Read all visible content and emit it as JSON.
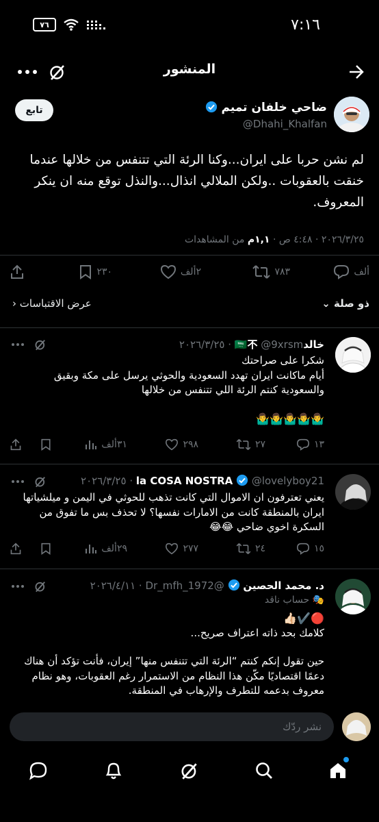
{
  "status_bar": {
    "time": "٧:١٦",
    "battery": "٧٦"
  },
  "header": {
    "title": "المنشور"
  },
  "post": {
    "author_name": "ضاحي خلفان تميم",
    "author_handle": "@Dhahi_Khalfan",
    "follow_label": "تابع",
    "text": "لم نشن حربا على ايران...وكنا الرئة التي تتنفس من خلالها عندما خنقت بالعقوبات ..ولكن الملالي انذال...والنذل توقع منه ان ينكر المعروف.",
    "time": "٤:٤٨ ص",
    "date": "٢٠٢٦/٣/٢٥",
    "views_count": "١,١م",
    "views_label": "من المشاهدات",
    "replies": "ألف",
    "reposts": "٧٨٣",
    "likes": "٢ألف",
    "bookmarks": "٢٣٠"
  },
  "replies_bar": {
    "sort_label": "ذو صلة",
    "quotes_label": "عرض الاقتباسات"
  },
  "replies": [
    {
      "name": "خالد🇸🇦不",
      "handle": "@9xrsm",
      "date": "٢٠٢٦/٣/٢٥",
      "text_lines": [
        "شكرا على صراحتك",
        "أيام ماكانت ايران تهدد السعودية والحوثي يرسل على مكة وبقيق والسعودية كنتم الرئة اللي تتنفس من خلالها",
        "",
        "🤷‍♂️🤷‍♂️🤷‍♂️🤷‍♂️🤷‍♂️"
      ],
      "reply_count": "١٣",
      "repost_count": "٢٧",
      "like_count": "٢٩٨",
      "view_count": "٣١ألف"
    },
    {
      "name": "la COSA NOSTRA",
      "handle": "@lovelyboy21",
      "date": "٢٠٢٦/٣/٢٥",
      "text_lines": [
        "يعني تعترفون ان الاموال التي كانت تذهب للحوثي في اليمن و ميلشياتها ايران بالمنطقة كانت من الامارات نفسها؟ لا تحذف بس ما تفوق من السكرة اخوي ضاحي 😂😂"
      ],
      "reply_count": "١٥",
      "repost_count": "٢٤",
      "like_count": "٢٧٧",
      "view_count": "٢٩ألف"
    },
    {
      "name": "د. محمد الحصين",
      "handle": "@Dr_mfh_1972",
      "date": "٢٠٢٦/٤/١١",
      "badge": "حساب ناقد",
      "text_lines": [
        "🔴✔️👍🏻",
        "كلامك بحد ذاته اعتراف صريح...",
        "",
        "حين تقول إنكم كنتم “الرئة التي تتنفس منها” إيران، فأنت تؤكد أن هناك دعمًا اقتصاديًا مكّن هذا النظام من الاستمرار رغم العقوبات، وهو نظام معروف بدعمه للتطرف والإرهاب في المنطقة."
      ]
    }
  ],
  "composer": {
    "placeholder": "نشر ردّك"
  },
  "colors": {
    "accent": "#1d9bf0",
    "background": "#000000",
    "muted": "#71767b",
    "divider": "#2f3336"
  }
}
